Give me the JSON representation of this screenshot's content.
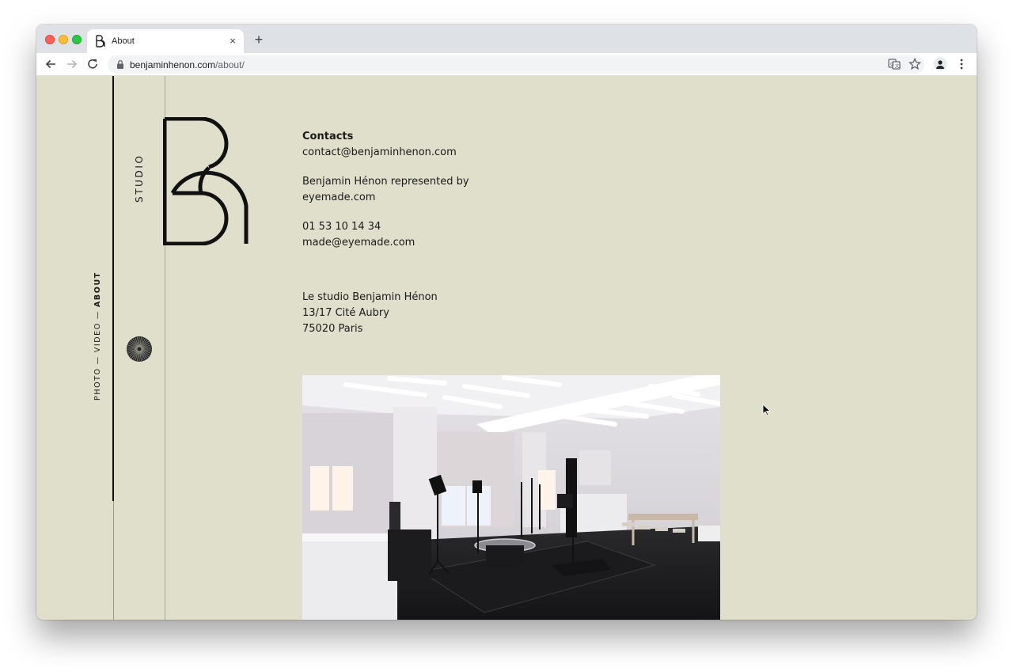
{
  "browser": {
    "tab_title": "About",
    "tab_close": "×",
    "new_tab": "+",
    "url_domain": "benjaminhenon.com",
    "url_path": "/about/"
  },
  "sidebar": {
    "nav_photo": "PHOTO",
    "nav_video": "VIDEO",
    "nav_about": "ABOUT",
    "separator": "—",
    "section_label": "STUDIO"
  },
  "contacts": {
    "heading": "Contacts",
    "email": "contact@benjaminhenon.com",
    "represented_line1": "Benjamin Hénon represented by",
    "represented_line2": "eyemade.com",
    "phone": "01 53 10 14 34",
    "agency_email": "made@eyemade.com"
  },
  "address": {
    "line1": "Le studio Benjamin Hénon",
    "line2": "13/17 Cité Aubry",
    "line3": "75020 Paris"
  },
  "colors": {
    "page_background": "#dfdfcc",
    "text": "#1a1a1a",
    "chrome_tabstrip": "#dee1e6"
  },
  "icons": {
    "back": "arrow-left-icon",
    "forward": "arrow-right-icon",
    "reload": "reload-icon",
    "lock": "lock-icon",
    "translate": "translate-icon",
    "bookmark": "star-icon",
    "profile": "avatar-icon",
    "menu": "kebab-menu-icon",
    "logo": "bh-monogram-logo",
    "sun": "sunburst-icon"
  }
}
